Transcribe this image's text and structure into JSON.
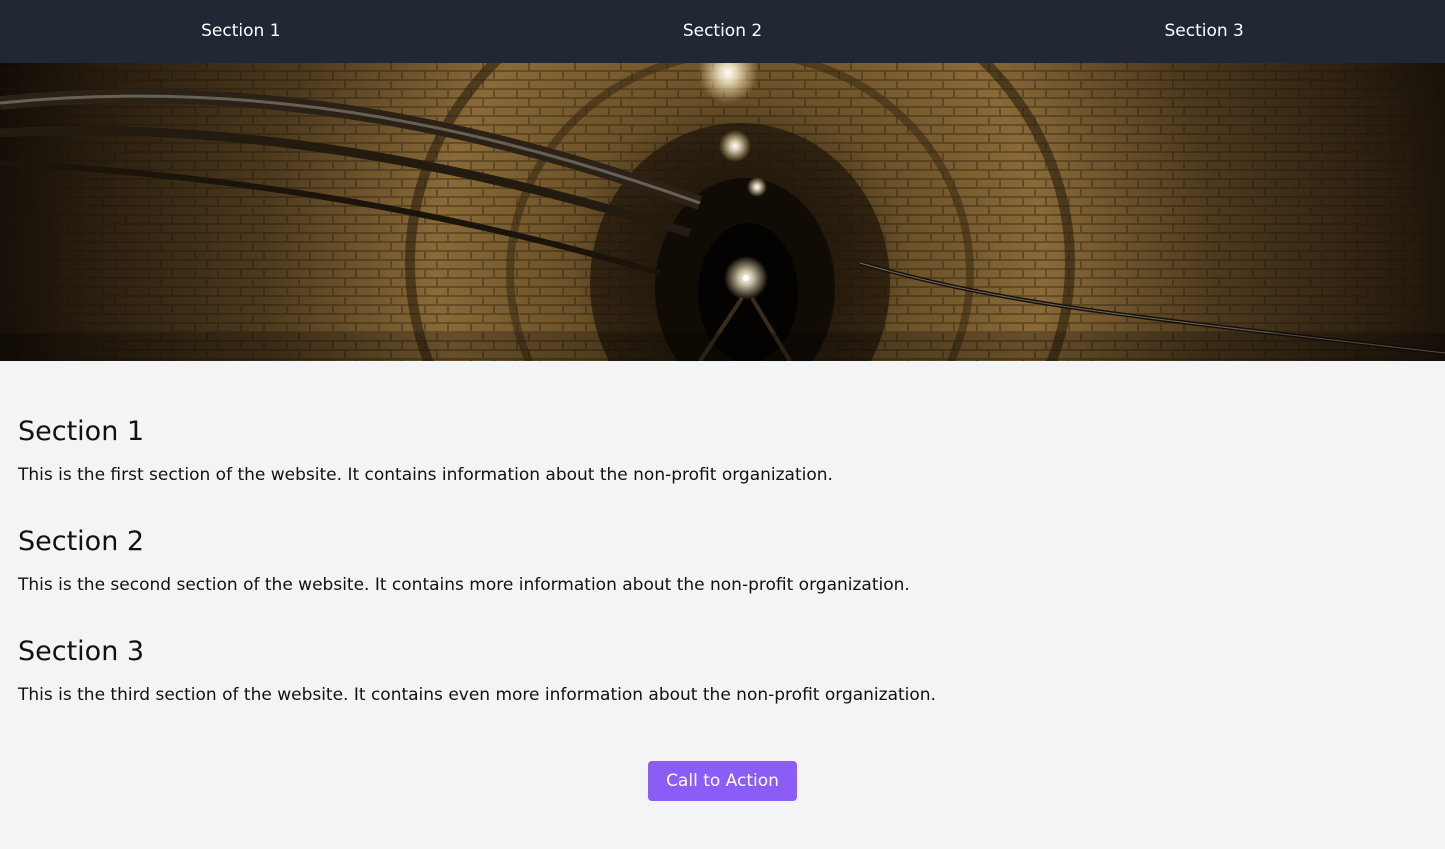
{
  "nav": {
    "items": [
      {
        "label": "Section 1"
      },
      {
        "label": "Section 2"
      },
      {
        "label": "Section 3"
      }
    ]
  },
  "colors": {
    "nav_bg": "#212833",
    "page_bg": "#f3f4f6",
    "accent": "#8b5cf6"
  },
  "sections": [
    {
      "title": "Section 1",
      "body": "This is the first section of the website. It contains information about the non-profit organization."
    },
    {
      "title": "Section 2",
      "body": "This is the second section of the website. It contains more information about the non-profit organization."
    },
    {
      "title": "Section 3",
      "body": "This is the third section of the website. It contains even more information about the non-profit organization."
    }
  ],
  "cta": {
    "label": "Call to Action"
  }
}
